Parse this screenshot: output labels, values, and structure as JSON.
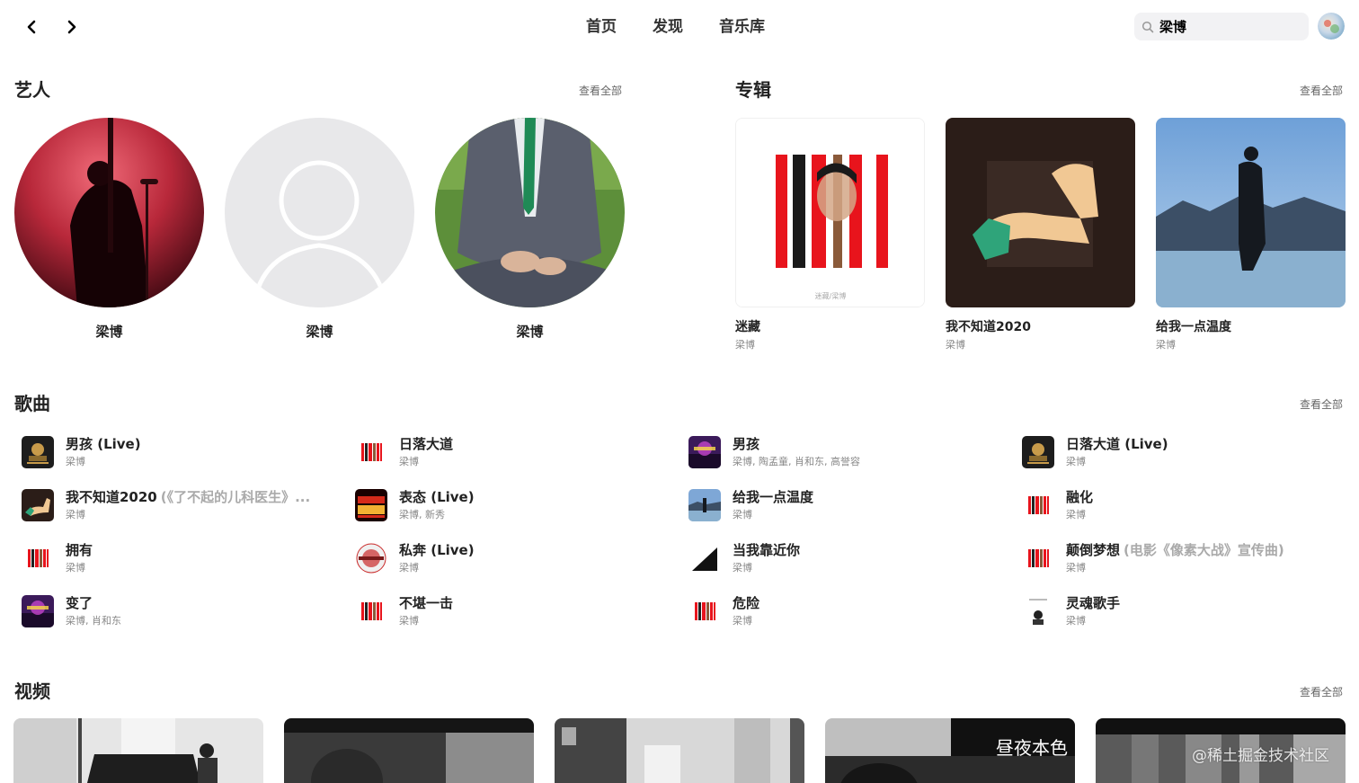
{
  "topbar": {
    "tabs": [
      "首页",
      "发现",
      "音乐库"
    ],
    "search_value": "梁博"
  },
  "artists_section": {
    "title": "艺人",
    "see_all": "查看全部",
    "items": [
      {
        "name": "梁博"
      },
      {
        "name": "梁博"
      },
      {
        "name": "梁博"
      }
    ]
  },
  "albums_section": {
    "title": "专辑",
    "see_all": "查看全部",
    "items": [
      {
        "title": "迷藏",
        "artist": "梁博",
        "cover_caption": "迷藏/梁博"
      },
      {
        "title": "我不知道2020",
        "artist": "梁博"
      },
      {
        "title": "给我一点温度",
        "artist": "梁博"
      }
    ]
  },
  "songs_section": {
    "title": "歌曲",
    "see_all": "查看全部",
    "columns": [
      [
        {
          "title": "男孩 (Live)",
          "subtitle": "",
          "artist": "梁博",
          "thumb": "concert-dark"
        },
        {
          "title": "我不知道2020",
          "subtitle": "(《了不起的儿科医生》...",
          "artist": "梁博",
          "thumb": "arm"
        },
        {
          "title": "拥有",
          "subtitle": "",
          "artist": "梁博",
          "thumb": "stripes"
        },
        {
          "title": "变了",
          "subtitle": "",
          "artist": "梁博, 肖和东",
          "thumb": "purple-stage"
        }
      ],
      [
        {
          "title": "日落大道",
          "subtitle": "",
          "artist": "梁博",
          "thumb": "stripes"
        },
        {
          "title": "表态 (Live)",
          "subtitle": "",
          "artist": "梁博, 新秀",
          "thumb": "red-poster"
        },
        {
          "title": "私奔 (Live)",
          "subtitle": "",
          "artist": "梁博",
          "thumb": "circle-badge"
        },
        {
          "title": "不堪一击",
          "subtitle": "",
          "artist": "梁博",
          "thumb": "stripes"
        }
      ],
      [
        {
          "title": "男孩",
          "subtitle": "",
          "artist": "梁博, 陶孟童, 肖和东, 高誉容",
          "thumb": "purple-stage"
        },
        {
          "title": "给我一点温度",
          "subtitle": "",
          "artist": "梁博",
          "thumb": "road"
        },
        {
          "title": "当我靠近你",
          "subtitle": "",
          "artist": "梁博",
          "thumb": "diagonal"
        },
        {
          "title": "危险",
          "subtitle": "",
          "artist": "梁博",
          "thumb": "stripes"
        }
      ],
      [
        {
          "title": "日落大道 (Live)",
          "subtitle": "",
          "artist": "梁博",
          "thumb": "concert-dark"
        },
        {
          "title": "融化",
          "subtitle": "",
          "artist": "梁博",
          "thumb": "stripes"
        },
        {
          "title": "颠倒梦想",
          "subtitle": "(电影《像素大战》宣传曲)",
          "artist": "梁博",
          "thumb": "stripes"
        },
        {
          "title": "灵魂歌手",
          "subtitle": "",
          "artist": "梁博",
          "thumb": "portrait-white"
        }
      ]
    ]
  },
  "videos_section": {
    "title": "视频",
    "see_all": "查看全部",
    "items": [
      {
        "thumb": "piano-studio",
        "overlay_text": ""
      },
      {
        "thumb": "bw-face",
        "overlay_text": ""
      },
      {
        "thumb": "bw-room",
        "overlay_text": ""
      },
      {
        "thumb": "bw-title",
        "overlay_text": "昼夜本色"
      },
      {
        "thumb": "bw-curtain",
        "overlay_text": ""
      }
    ]
  },
  "watermark": "@稀土掘金技术社区",
  "colors": {
    "accent_red": "#e8141c",
    "text_primary": "#222222",
    "text_secondary": "#888888",
    "search_bg": "#f2f2f4"
  }
}
